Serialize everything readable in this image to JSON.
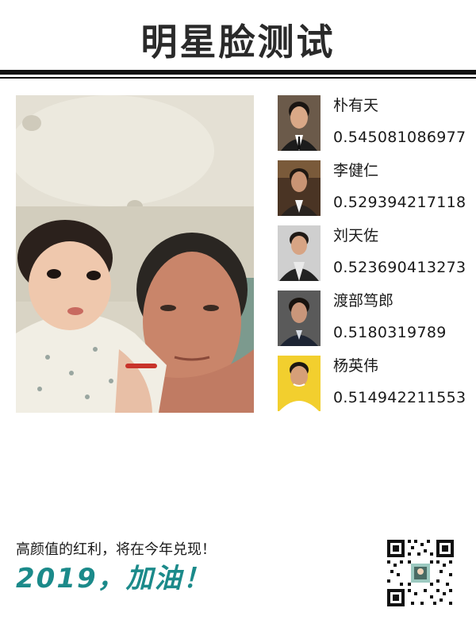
{
  "header": {
    "title": "明星脸测试"
  },
  "photo": {
    "alt": "user-uploaded selfie"
  },
  "results": [
    {
      "name": "朴有天",
      "score": "0.545081086977",
      "thumb_bg": "#6b5a4a",
      "shirt": "#1c1c1c"
    },
    {
      "name": "李健仁",
      "score": "0.529394217118",
      "thumb_bg": "#4a3424",
      "shirt": "#2a2420"
    },
    {
      "name": "刘天佐",
      "score": "0.523690413273",
      "thumb_bg": "#cfcfcf",
      "shirt": "#222222"
    },
    {
      "name": "渡部笃郎",
      "score": "0.5180319789",
      "thumb_bg": "#5a5a5a",
      "shirt": "#1d2433"
    },
    {
      "name": "杨英伟",
      "score": "0.514942211553",
      "thumb_bg": "#f2cf2e",
      "shirt": "#ffffff"
    }
  ],
  "footer": {
    "slogan": "高颜值的红利，将在今年兑现！",
    "cheer": "2019，加油！",
    "cheer_color": "#1b8a8a",
    "qr_icon": "qr-code-icon"
  }
}
